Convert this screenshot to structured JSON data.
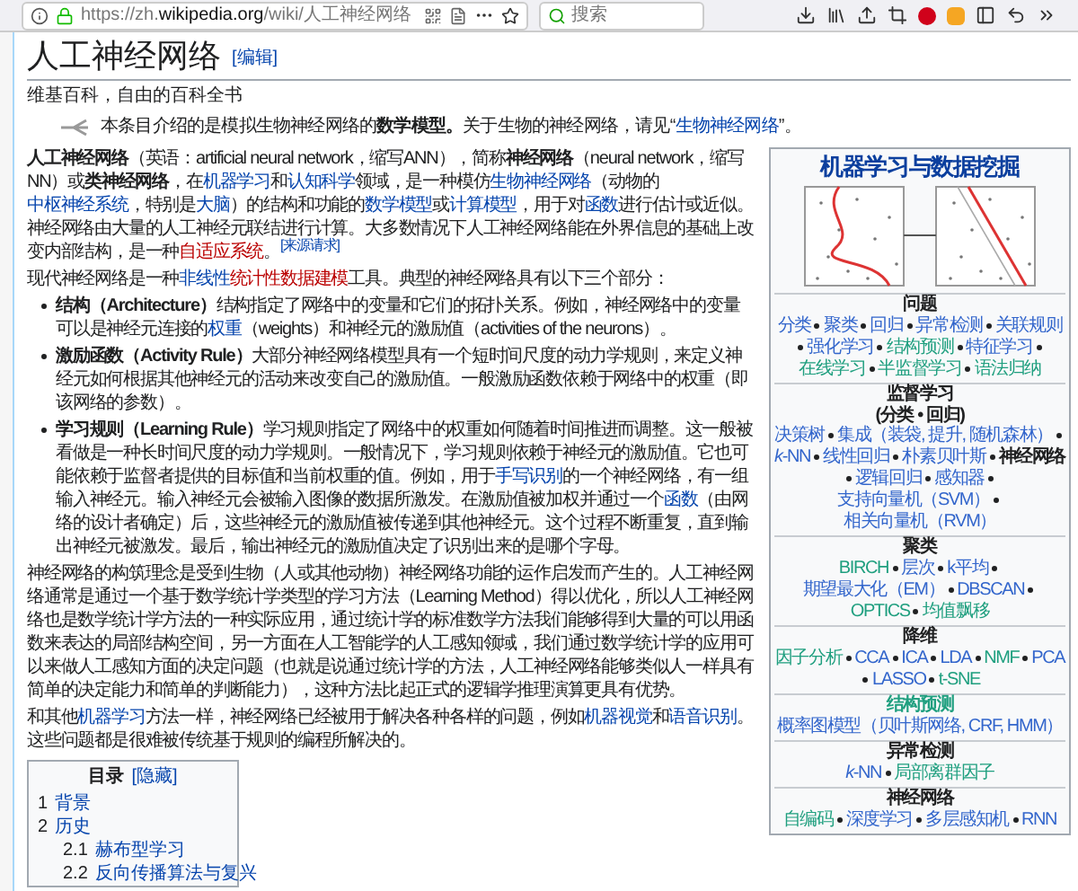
{
  "browser": {
    "url_scheme": "https://zh.",
    "url_domain": "wikipedia.org",
    "url_path": "/wiki/人工神经网络",
    "search_placeholder": "搜索"
  },
  "article": {
    "title": "人工神经网络",
    "edit_link": "[编辑]",
    "tagline": "维基百科，自由的百科全书",
    "hatnote": [
      {
        "kind": "t",
        "text": "本条目介绍的是模拟生物神经网络的"
      },
      {
        "kind": "b",
        "text": "数学模型。"
      },
      {
        "kind": "t",
        "text": "关于生物的神经网络，请见“"
      },
      {
        "kind": "a",
        "text": "生物神经网络"
      },
      {
        "kind": "t",
        "text": "”。"
      }
    ]
  },
  "body": [
    {
      "kind": "p",
      "segments": [
        {
          "kind": "b",
          "text": "人工神经网络"
        },
        {
          "kind": "t",
          "text": "（英语：artificial neural network，缩写ANN），简称"
        },
        {
          "kind": "b",
          "text": "神经网络"
        },
        {
          "kind": "t",
          "text": "（neural network，缩写NN）或"
        },
        {
          "kind": "b",
          "text": "类神经网络"
        },
        {
          "kind": "t",
          "text": "，在"
        },
        {
          "kind": "a",
          "text": "机器学习"
        },
        {
          "kind": "t",
          "text": "和"
        },
        {
          "kind": "a",
          "text": "认知科学"
        },
        {
          "kind": "t",
          "text": "领域，是一种模仿"
        },
        {
          "kind": "a",
          "text": "生物神经网络"
        },
        {
          "kind": "t",
          "text": "（动物的"
        },
        {
          "kind": "a",
          "text": "中枢神经系统"
        },
        {
          "kind": "t",
          "text": "，特别是"
        },
        {
          "kind": "a",
          "text": "大脑"
        },
        {
          "kind": "t",
          "text": "）的结构和功能的"
        },
        {
          "kind": "a",
          "text": "数学模型"
        },
        {
          "kind": "t",
          "text": "或"
        },
        {
          "kind": "a",
          "text": "计算模型"
        },
        {
          "kind": "t",
          "text": "，用于对"
        },
        {
          "kind": "a",
          "text": "函数"
        },
        {
          "kind": "t",
          "text": "进行估计或近似。神经网络由大量的人工神经元联结进行计算。大多数情况下人工神经网络能在外界信息的基础上改变内部结构，是一种"
        },
        {
          "kind": "r",
          "text": "自适应系统"
        },
        {
          "kind": "t",
          "text": "。"
        },
        {
          "kind": "s",
          "text": "[来源请求]"
        }
      ]
    },
    {
      "kind": "p",
      "segments": [
        {
          "kind": "t",
          "text": "现代神经网络是一种"
        },
        {
          "kind": "a",
          "text": "非线性"
        },
        {
          "kind": "r",
          "text": "统计性数据建模"
        },
        {
          "kind": "t",
          "text": "工具。典型的神经网络具有以下三个部分："
        }
      ]
    },
    {
      "kind": "bullet",
      "segments": [
        {
          "kind": "b",
          "text": "结构（Architecture）"
        },
        {
          "kind": "t",
          "text": "结构指定了网络中的变量和它们的拓扑关系。例如，神经网络中的变量可以是神经元连接的"
        },
        {
          "kind": "a",
          "text": "权重"
        },
        {
          "kind": "t",
          "text": "（weights）和神经元的激励值（activities of the neurons）。"
        }
      ]
    },
    {
      "kind": "bullet",
      "segments": [
        {
          "kind": "b",
          "text": "激励函数（Activity Rule）"
        },
        {
          "kind": "t",
          "text": "大部分神经网络模型具有一个短时间尺度的动力学规则，来定义神经元如何根据其他神经元的活动来改变自己的激励值。一般激励函数依赖于网络中的权重（即该网络的参数）。"
        }
      ]
    },
    {
      "kind": "bullet",
      "segments": [
        {
          "kind": "b",
          "text": "学习规则（Learning Rule）"
        },
        {
          "kind": "t",
          "text": "学习规则指定了网络中的权重如何随着时间推进而调整。这一般被看做是一种长时间尺度的动力学规则。一般情况下，学习规则依赖于神经元的激励值。它也可能依赖于监督者提供的目标值和当前权重的值。例如，用于"
        },
        {
          "kind": "a",
          "text": "手写识别"
        },
        {
          "kind": "t",
          "text": "的一个神经网络，有一组输入神经元。输入神经元会被输入图像的数据所激发。在激励值被加权并通过一个"
        },
        {
          "kind": "a",
          "text": "函数"
        },
        {
          "kind": "t",
          "text": "（由网络的设计者确定）后，这些神经元的激励值被传递到其他神经元。这个过程不断重复，直到输出神经元被激发。最后，输出神经元的激励值决定了识别出来的是哪个字母。"
        }
      ]
    },
    {
      "kind": "p",
      "segments": [
        {
          "kind": "t",
          "text": "神经网络的构筑理念是受到生物（人或其他动物）神经网络功能的运作启发而产生的。人工神经网络通常是通过一个基于数学统计学类型的学习方法（Learning Method）得以优化，所以人工神经网络也是数学统计学方法的一种实际应用，通过统计学的标准数学方法我们能够得到大量的可以用函数来表达的局部结构空间，另一方面在人工智能学的人工感知领域，我们通过数学统计学的应用可以来做人工感知方面的决定问题（也就是说通过统计学的方法，人工神经网络能够类似人一样具有简单的决定能力和简单的判断能力），这种方法比起正式的逻辑学推理演算更具有优势。"
        }
      ]
    },
    {
      "kind": "p",
      "segments": [
        {
          "kind": "t",
          "text": "和其他"
        },
        {
          "kind": "a",
          "text": "机器学习"
        },
        {
          "kind": "t",
          "text": "方法一样，神经网络已经被用于解决各种各样的问题，例如"
        },
        {
          "kind": "a",
          "text": "机器视觉"
        },
        {
          "kind": "t",
          "text": "和"
        },
        {
          "kind": "a",
          "text": "语音识别"
        },
        {
          "kind": "t",
          "text": "。这些问题都是很难被传统基于规则的编程所解决的。"
        }
      ]
    }
  ],
  "toc": {
    "title": "目录",
    "toggle": "[隐藏]",
    "items": [
      {
        "number": "1",
        "label": "背景"
      },
      {
        "number": "2",
        "label": "历史",
        "children": [
          {
            "number": "2.1",
            "label": "赫布型学习"
          },
          {
            "number": "2.2",
            "label": "反向传播算法与复兴"
          }
        ]
      }
    ]
  },
  "infobox": {
    "title": "机器学习与数据挖掘",
    "sections": [
      {
        "title": "问题",
        "color": "#202122",
        "items": [
          {
            "label": "分类",
            "kind": "link",
            "color": "#3366cc"
          },
          {
            "label": "聚类",
            "kind": "link",
            "color": "#3366cc"
          },
          {
            "label": "回归",
            "kind": "link",
            "color": "#3366cc"
          },
          {
            "label": "异常检测",
            "kind": "link",
            "color": "#3366cc"
          },
          {
            "label": "关联规则",
            "kind": "link",
            "color": "#3366cc"
          },
          {
            "label": "强化学习",
            "kind": "link",
            "color": "#3366cc"
          },
          {
            "label": "结构预测",
            "kind": "link",
            "color": "#1f9f7f"
          },
          {
            "label": "特征学习",
            "kind": "link",
            "color": "#3366cc"
          },
          {
            "label": "在线学习",
            "kind": "link",
            "color": "#1f9f7f"
          },
          {
            "label": "半监督学习",
            "kind": "link",
            "color": "#1f9f7f"
          },
          {
            "label": "语法归纳",
            "kind": "link",
            "color": "#1f9f7f"
          }
        ]
      },
      {
        "title": "监督学习",
        "color": "#202122",
        "subtitle": "(分类 • 回归)",
        "items": [
          {
            "label": "决策树",
            "kind": "link",
            "color": "#3366cc"
          },
          {
            "label": "集成（装袋, 提升, 随机森林）",
            "kind": "link",
            "color": "#3366cc"
          },
          {
            "label": "*k*-NN",
            "kind": "link",
            "color": "#3366cc"
          },
          {
            "label": "线性回归",
            "kind": "link",
            "color": "#3366cc"
          },
          {
            "label": "朴素贝叶斯",
            "kind": "link",
            "color": "#3366cc"
          },
          {
            "label": "神经网络",
            "kind": "self",
            "color": "#202122"
          },
          {
            "label": "逻辑回归",
            "kind": "link",
            "color": "#3366cc"
          },
          {
            "label": "感知器",
            "kind": "link",
            "color": "#3366cc"
          },
          {
            "label": "支持向量机（SVM）",
            "kind": "link",
            "color": "#3366cc"
          },
          {
            "label": "相关向量机（RVM）",
            "kind": "link",
            "color": "#3366cc"
          }
        ]
      },
      {
        "title": "聚类",
        "color": "#202122",
        "items": [
          {
            "label": "BIRCH",
            "kind": "link",
            "color": "#1f9f7f"
          },
          {
            "label": "层次",
            "kind": "link",
            "color": "#3366cc"
          },
          {
            "label": "k平均",
            "kind": "link",
            "color": "#3366cc"
          },
          {
            "label": "期望最大化（EM）",
            "kind": "link",
            "color": "#3366cc"
          },
          {
            "label": "DBSCAN",
            "kind": "link",
            "color": "#3366cc"
          },
          {
            "label": "OPTICS",
            "kind": "link",
            "color": "#1f9f7f"
          },
          {
            "label": "均值飘移",
            "kind": "link",
            "color": "#1f9f7f"
          }
        ]
      },
      {
        "title": "降维",
        "color": "#202122",
        "items": [
          {
            "label": "因子分析",
            "kind": "link",
            "color": "#1f9f7f"
          },
          {
            "label": "CCA",
            "kind": "link",
            "color": "#3366cc"
          },
          {
            "label": "ICA",
            "kind": "link",
            "color": "#3366cc"
          },
          {
            "label": "LDA",
            "kind": "link",
            "color": "#3366cc"
          },
          {
            "label": "NMF",
            "kind": "link",
            "color": "#1f9f7f"
          },
          {
            "label": "PCA",
            "kind": "link",
            "color": "#3366cc"
          },
          {
            "label": "LASSO",
            "kind": "link",
            "color": "#3366cc"
          },
          {
            "label": "t-SNE",
            "kind": "link",
            "color": "#1f9f7f"
          }
        ]
      },
      {
        "title": "结构预测",
        "color": "#1f9f7f",
        "items": [
          {
            "label": "概率图模型（贝叶斯网络, CRF, HMM）",
            "kind": "link",
            "color": "#3366cc"
          }
        ]
      },
      {
        "title": "异常检测",
        "color": "#202122",
        "items": [
          {
            "label": "*k*-NN",
            "kind": "link",
            "color": "#3366cc"
          },
          {
            "label": "局部离群因子",
            "kind": "link",
            "color": "#1f9f7f"
          }
        ]
      },
      {
        "title": "神经网络",
        "color": "#202122",
        "items": [
          {
            "label": "自编码",
            "kind": "link",
            "color": "#1f9f7f"
          },
          {
            "label": "深度学习",
            "kind": "link",
            "color": "#3366cc"
          },
          {
            "label": "多层感知机",
            "kind": "link",
            "color": "#3366cc"
          },
          {
            "label": "RNN",
            "kind": "link",
            "color": "#3366cc"
          }
        ]
      }
    ]
  }
}
